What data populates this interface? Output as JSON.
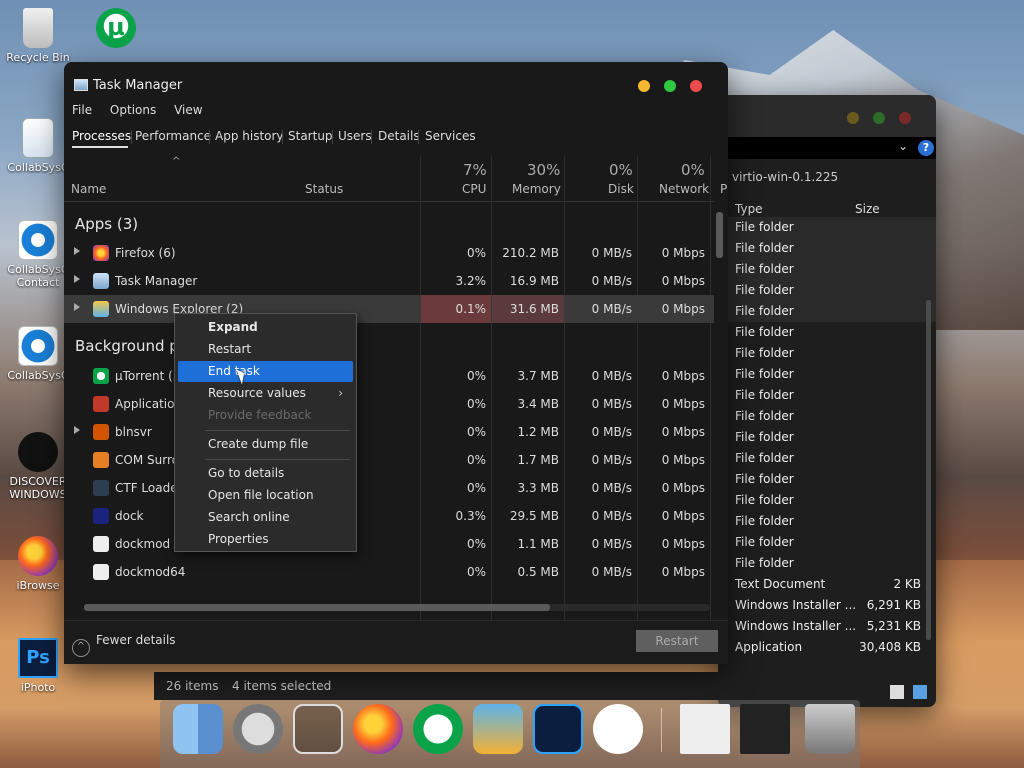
{
  "desktop": {
    "icons": [
      {
        "label": "Recycle Bin",
        "icon": "recycle-bin-icon"
      },
      {
        "label": "",
        "icon": "utorrent-icon"
      },
      {
        "label": "CollabSysC",
        "icon": "file-icon"
      },
      {
        "label": "CollabSysC Contact",
        "icon": "ie-icon"
      },
      {
        "label": "CollabSysC",
        "icon": "ie-icon"
      },
      {
        "label": "DISCOVER WINDOWS",
        "icon": "apple-icon"
      },
      {
        "label": "iBrowse",
        "icon": "firefox-icon"
      },
      {
        "label": "iPhoto",
        "icon": "photoshop-icon"
      }
    ]
  },
  "explorer": {
    "path": "virtio-win-0.1.225",
    "help": "?",
    "columns": {
      "type": "Type",
      "size": "Size"
    },
    "rows": [
      {
        "type": "File folder",
        "size": ""
      },
      {
        "type": "File folder",
        "size": ""
      },
      {
        "type": "File folder",
        "size": ""
      },
      {
        "type": "File folder",
        "size": ""
      },
      {
        "type": "File folder",
        "size": ""
      },
      {
        "type": "File folder",
        "size": ""
      },
      {
        "type": "File folder",
        "size": ""
      },
      {
        "type": "File folder",
        "size": ""
      },
      {
        "type": "File folder",
        "size": ""
      },
      {
        "type": "File folder",
        "size": ""
      },
      {
        "type": "File folder",
        "size": ""
      },
      {
        "type": "File folder",
        "size": ""
      },
      {
        "type": "File folder",
        "size": ""
      },
      {
        "type": "File folder",
        "size": ""
      },
      {
        "type": "File folder",
        "size": ""
      },
      {
        "type": "File folder",
        "size": ""
      },
      {
        "type": "File folder",
        "size": ""
      },
      {
        "type": "Text Document",
        "size": "2 KB"
      },
      {
        "type": "Windows Installer ...",
        "size": "6,291 KB"
      },
      {
        "type": "Windows Installer ...",
        "size": "5,231 KB"
      },
      {
        "type": "Application",
        "size": "30,408 KB"
      }
    ]
  },
  "taskmanager": {
    "title": "Task Manager",
    "menu": [
      "File",
      "Options",
      "View"
    ],
    "tabs": [
      "Processes",
      "Performance",
      "App history",
      "Startup",
      "Users",
      "Details",
      "Services"
    ],
    "columns": {
      "name": "Name",
      "status": "Status",
      "cpu_pct": "7%",
      "cpu": "CPU",
      "mem_pct": "30%",
      "mem": "Memory",
      "disk_pct": "0%",
      "disk": "Disk",
      "net_pct": "0%",
      "net": "Network",
      "power": "P"
    },
    "sections": {
      "apps": "Apps (3)",
      "background": "Background pr"
    },
    "apps": [
      {
        "name": "Firefox (6)",
        "cpu": "0%",
        "mem": "210.2 MB",
        "disk": "0 MB/s",
        "net": "0 Mbps"
      },
      {
        "name": "Task Manager",
        "cpu": "3.2%",
        "mem": "16.9 MB",
        "disk": "0 MB/s",
        "net": "0 Mbps"
      },
      {
        "name": "Windows Explorer (2)",
        "cpu": "0.1%",
        "mem": "31.6 MB",
        "disk": "0 MB/s",
        "net": "0 Mbps"
      }
    ],
    "background": [
      {
        "name": "µTorrent (3",
        "cpu": "0%",
        "mem": "3.7 MB",
        "disk": "0 MB/s",
        "net": "0 Mbps"
      },
      {
        "name": "Application",
        "cpu": "0%",
        "mem": "3.4 MB",
        "disk": "0 MB/s",
        "net": "0 Mbps"
      },
      {
        "name": "blnsvr",
        "cpu": "0%",
        "mem": "1.2 MB",
        "disk": "0 MB/s",
        "net": "0 Mbps"
      },
      {
        "name": "COM Surro",
        "cpu": "0%",
        "mem": "1.7 MB",
        "disk": "0 MB/s",
        "net": "0 Mbps"
      },
      {
        "name": "CTF Loader",
        "cpu": "0%",
        "mem": "3.3 MB",
        "disk": "0 MB/s",
        "net": "0 Mbps"
      },
      {
        "name": "dock",
        "cpu": "0.3%",
        "mem": "29.5 MB",
        "disk": "0 MB/s",
        "net": "0 Mbps"
      },
      {
        "name": "dockmod (",
        "cpu": "0%",
        "mem": "1.1 MB",
        "disk": "0 MB/s",
        "net": "0 Mbps"
      },
      {
        "name": "dockmod64",
        "cpu": "0%",
        "mem": "0.5 MB",
        "disk": "0 MB/s",
        "net": "0 Mbps"
      }
    ],
    "fewer_details": "Fewer details",
    "restart": "Restart"
  },
  "context_menu": {
    "items": [
      "Expand",
      "Restart",
      "End task",
      "Resource values",
      "Provide feedback",
      "Create dump file",
      "Go to details",
      "Open file location",
      "Search online",
      "Properties"
    ]
  },
  "statusbar": {
    "items": "26 items",
    "selected": "4 items selected"
  },
  "colors": {
    "accent": "#1f6fd8",
    "highlight_cell": "#6b3a3c",
    "bg": "#191919"
  }
}
